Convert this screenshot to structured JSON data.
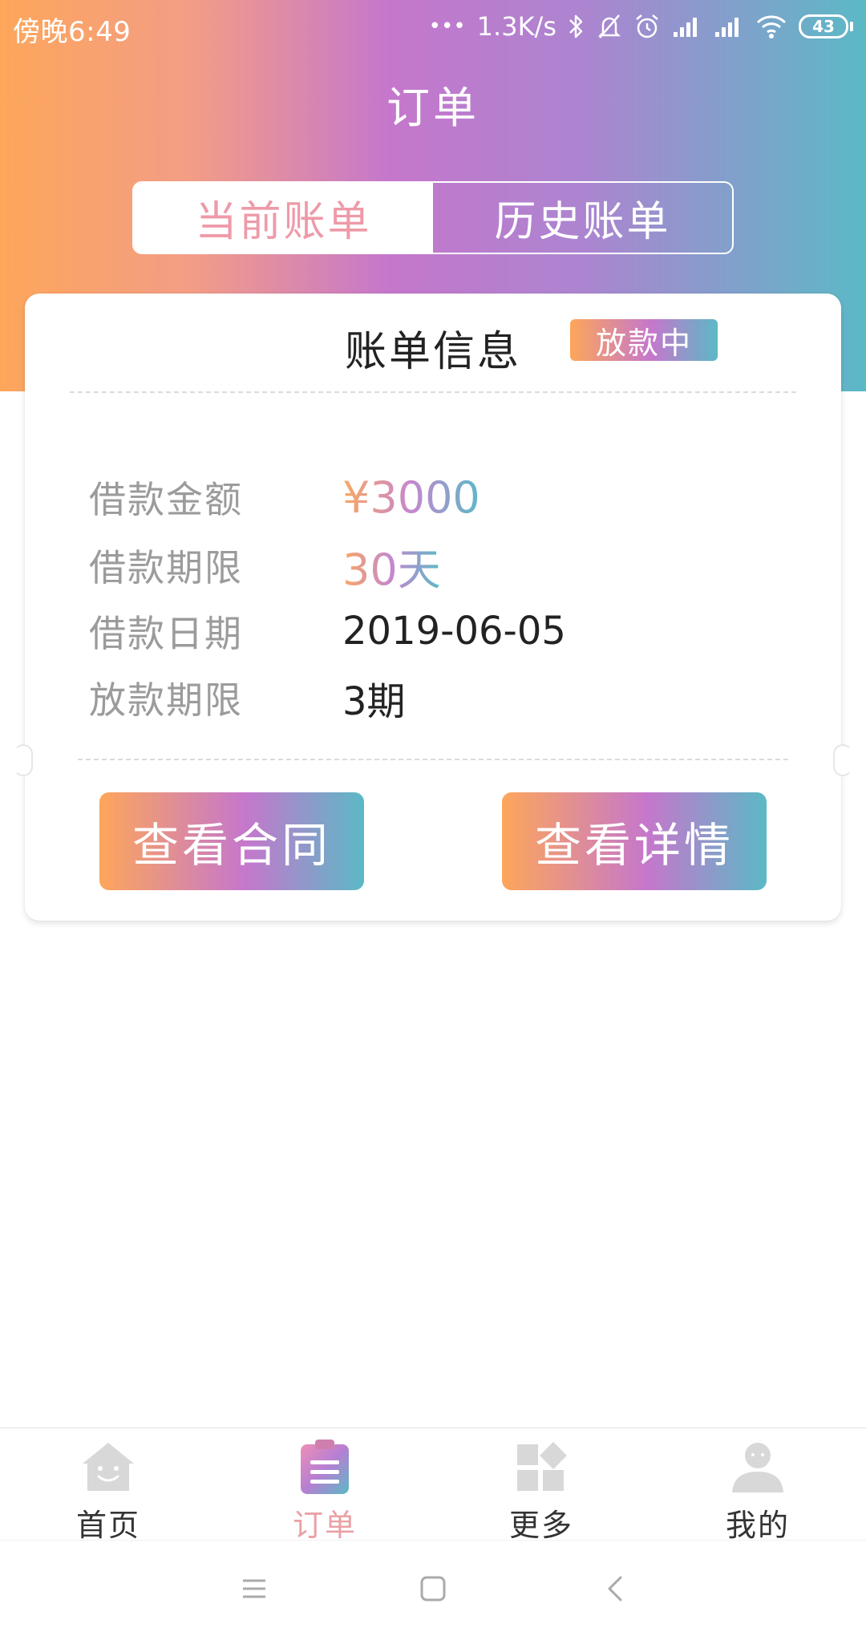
{
  "status_bar": {
    "time": "傍晚6:49",
    "dots": "•••",
    "network_speed": "1.3K/s",
    "battery": "43"
  },
  "header": {
    "title": "订单"
  },
  "tabs": [
    {
      "label": "当前账单",
      "active": true
    },
    {
      "label": "历史账单",
      "active": false
    }
  ],
  "card": {
    "title": "账单信息",
    "status": "放款中",
    "rows": [
      {
        "label": "借款金额",
        "value": "¥3000"
      },
      {
        "label": "借款期限",
        "value": "30天"
      },
      {
        "label": "借款日期",
        "value": "2019-06-05"
      },
      {
        "label": "放款期限",
        "value": "3期"
      }
    ],
    "buttons": {
      "contract": "查看合同",
      "details": "查看详情"
    }
  },
  "bottom_nav": [
    {
      "label": "首页",
      "icon": "home-icon",
      "active": false
    },
    {
      "label": "订单",
      "icon": "order-icon",
      "active": true
    },
    {
      "label": "更多",
      "icon": "more-icon",
      "active": false
    },
    {
      "label": "我的",
      "icon": "profile-icon",
      "active": false
    }
  ],
  "colors": {
    "gradient_start": "#fda65b",
    "gradient_mid": "#c577cc",
    "gradient_end": "#5bb9c6",
    "active_tab_text": "#ee9aa8",
    "inactive_gray": "#d6d6d6"
  }
}
